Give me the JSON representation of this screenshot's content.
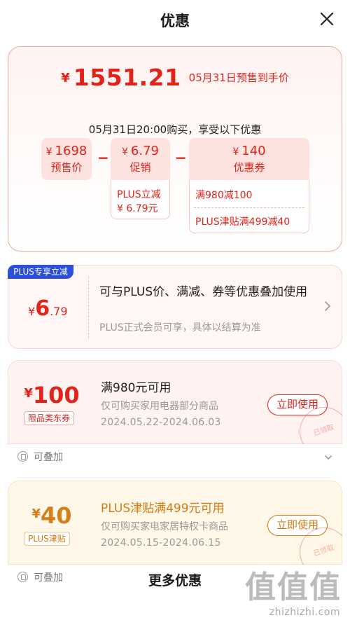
{
  "header": {
    "title": "优惠"
  },
  "summary": {
    "currency": "¥",
    "final_price": "1551.21",
    "price_note": "05月31日预售到手价",
    "subtitle": "05月31日20:00购买，享受以下优惠",
    "presale": {
      "value": "1698",
      "label": "预售价"
    },
    "promo": {
      "value": "6.79",
      "label": "促销",
      "detail_line1": "PLUS立减",
      "detail_line2": "¥ 6.79元"
    },
    "coupon": {
      "value": "140",
      "label": "优惠券",
      "detail_line1": "满980减100",
      "detail_line2": "PLUS津贴满499减40"
    },
    "minus": "−"
  },
  "plus_card": {
    "badge": "PLUS专享立减",
    "currency": "¥",
    "amount_int": "6",
    "amount_dec": ".79",
    "description": "可与PLUS价、满减、券等优惠叠加使用",
    "sub": "PLUS正式会员可享，具体以结算为准"
  },
  "coupons": [
    {
      "currency": "¥",
      "amount": "100",
      "tag": "限品类东券",
      "title": "满980元可用",
      "line2": "仅可购买家用电器部分商品",
      "line3": "2024.05.22-2024.06.03",
      "button": "立即使用",
      "stamp": "已领取",
      "stack": "可叠加"
    },
    {
      "currency": "¥",
      "amount": "40",
      "tag": "PLUS津贴",
      "title": "PLUS津贴满499元可用",
      "line2": "仅可购买家电家居特权卡商品",
      "line3": "2024.05.15-2024.06.15",
      "button": "立即使用",
      "stamp": "已领取",
      "stack": "可叠加"
    }
  ],
  "footer": {
    "more": "更多优惠"
  },
  "watermark": {
    "big": "值值值",
    "small": "zhizhizhi.com"
  },
  "colors": {
    "accent_red": "#e2231a",
    "accent_orange": "#d37a12",
    "plus_blue": "#2b4fd8"
  }
}
